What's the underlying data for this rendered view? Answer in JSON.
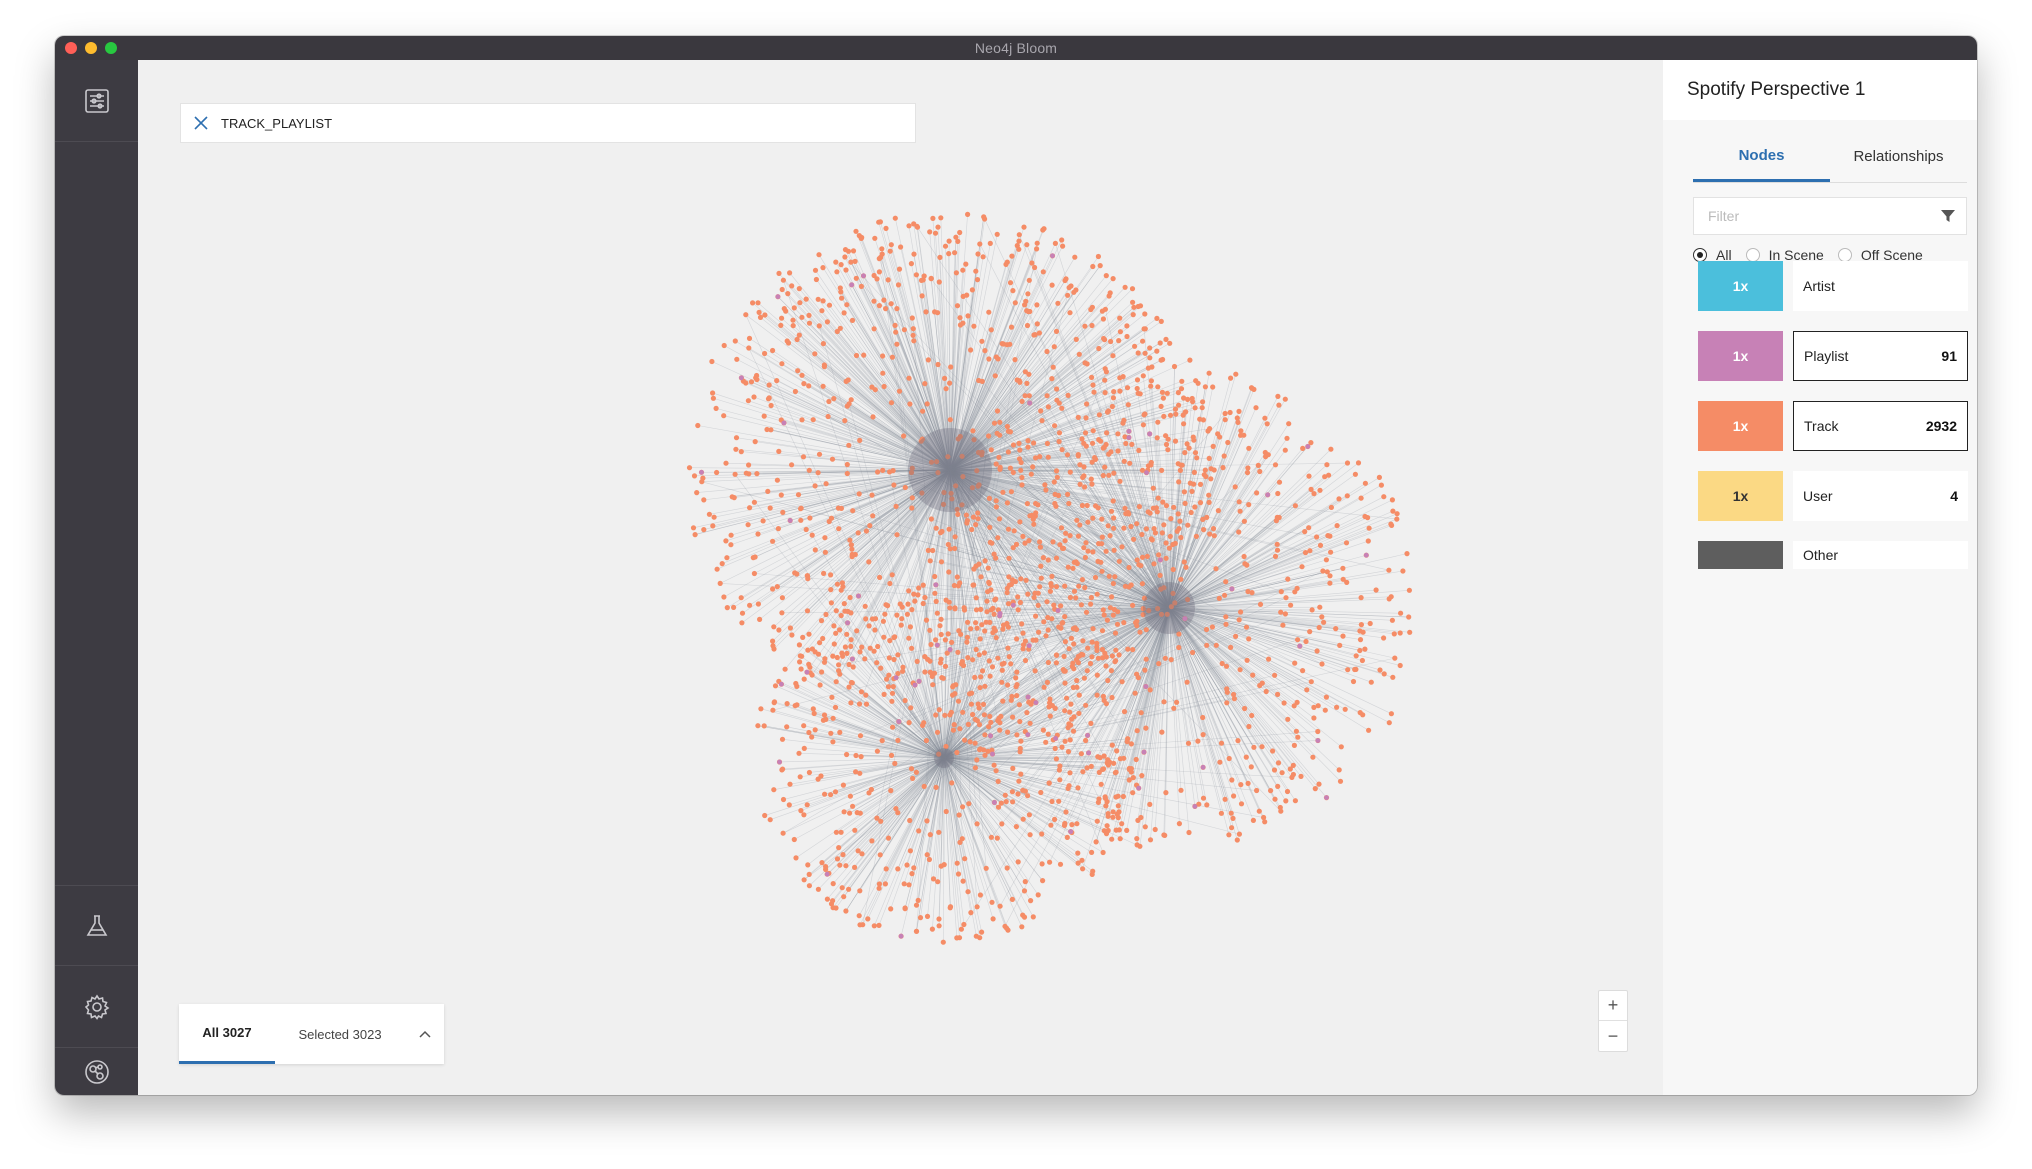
{
  "window": {
    "title": "Neo4j Bloom"
  },
  "leftbar": {
    "items": [
      {
        "icon": "perspective-settings-icon"
      },
      {
        "icon": "flask-icon"
      },
      {
        "icon": "gear-icon"
      },
      {
        "icon": "neo4j-logo-icon"
      }
    ]
  },
  "search": {
    "query": "TRACK_PLAYLIST"
  },
  "bottom_tabs": {
    "all_label": "All 3027",
    "selected_label": "Selected 3023"
  },
  "zoom": {
    "in_label": "+",
    "out_label": "−"
  },
  "panel": {
    "title": "Spotify Perspective 1",
    "tabs": [
      {
        "label": "Nodes",
        "active": true
      },
      {
        "label": "Relationships",
        "active": false
      }
    ],
    "filter_placeholder": "Filter",
    "radios": [
      {
        "label": "All",
        "checked": true
      },
      {
        "label": "In Scene",
        "checked": false
      },
      {
        "label": "Off Scene",
        "checked": false
      }
    ],
    "categories": [
      {
        "name": "Artist",
        "size_label": "1x",
        "color": "#4bbfdc",
        "count": "",
        "selected": false
      },
      {
        "name": "Playlist",
        "size_label": "1x",
        "color": "#c781b6",
        "count": "91",
        "selected": true
      },
      {
        "name": "Track",
        "size_label": "1x",
        "color": "#f58c66",
        "count": "2932",
        "selected": true
      },
      {
        "name": "User",
        "size_label": "1x",
        "color": "#fbd984",
        "count": "4",
        "selected": false
      },
      {
        "name": "Other",
        "size_label": "",
        "color": "#5e5e5e",
        "count": "",
        "selected": false
      }
    ]
  },
  "graph_colors": {
    "track": "#f58c66",
    "edge": "#8a8f99",
    "playlist": "#c781b6",
    "hub": "#6e6a7a"
  }
}
